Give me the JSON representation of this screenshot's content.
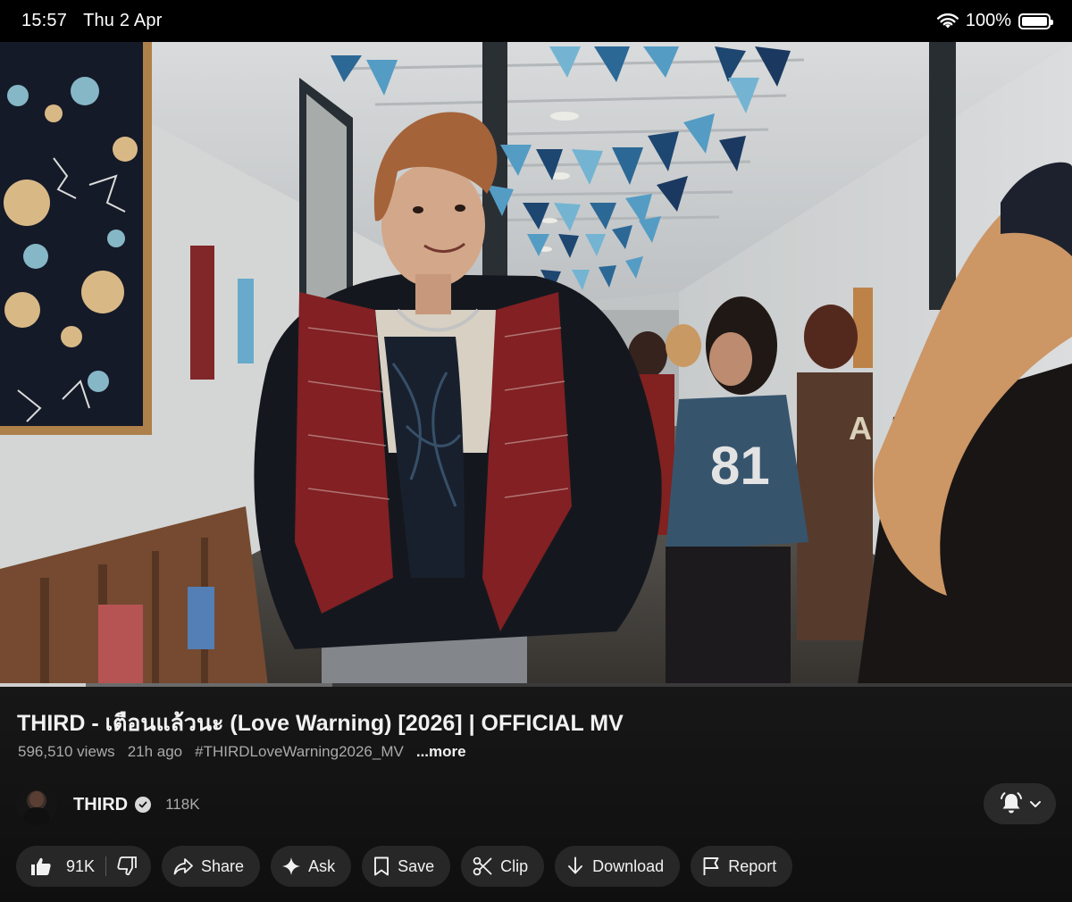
{
  "status_bar": {
    "time": "15:57",
    "date": "Thu 2 Apr",
    "battery": "100%"
  },
  "video": {
    "jersey_number": "81",
    "progress": {
      "played_fraction": 0.08,
      "buffered_fraction": 0.31
    }
  },
  "details": {
    "title": "THIRD - เตือนแล้วนะ (Love Warning) [2026] | OFFICIAL MV",
    "views": "596,510 views",
    "age": "21h ago",
    "hashtag": "#THIRDLoveWarning2026_MV",
    "more": "...more"
  },
  "channel": {
    "name": "THIRD",
    "subscribers": "118K"
  },
  "actions": {
    "likes": "91K",
    "share": "Share",
    "ask": "Ask",
    "save": "Save",
    "clip": "Clip",
    "download": "Download",
    "report": "Report"
  },
  "icons": {
    "wifi": "wifi-icon",
    "battery": "battery-icon",
    "verified": "verified-icon",
    "bell": "bell-icon",
    "like": "thumb-up-icon",
    "dislike": "thumb-down-icon",
    "share": "share-arrow-icon",
    "ask": "sparkle-icon",
    "save": "bookmark-icon",
    "clip": "scissors-icon",
    "download": "download-arrow-icon",
    "report": "flag-icon"
  },
  "colors": {
    "background": "#0f0f0f",
    "pill": "#272727",
    "text": "#f1f1f1",
    "secondary_text": "#aaaaaa"
  }
}
